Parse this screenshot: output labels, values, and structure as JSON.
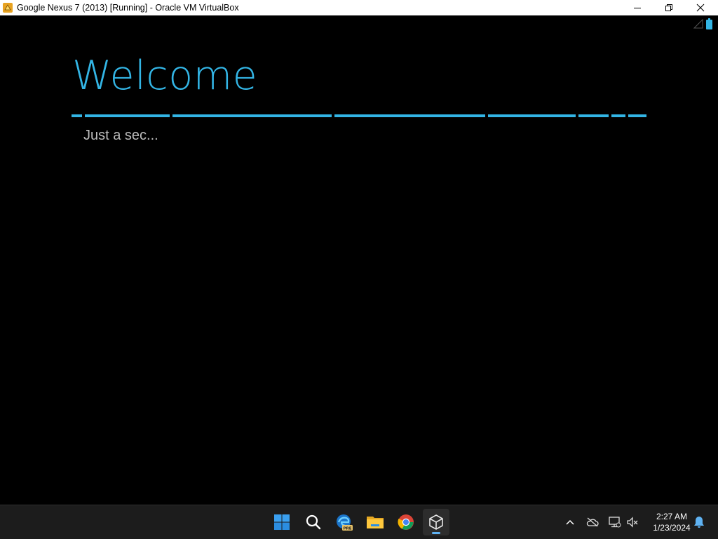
{
  "window": {
    "title": "Google Nexus 7 (2013) [Running] - Oracle VM VirtualBox",
    "controls": [
      "minimize",
      "restore",
      "close"
    ]
  },
  "android": {
    "status_icons": [
      "signal-icon",
      "battery-icon"
    ],
    "welcome_title": "Welcome",
    "subtitle": "Just a sec...",
    "accent_color": "#33b5e5"
  },
  "taskbar": {
    "apps": [
      {
        "name": "start",
        "icon": "windows-start-icon"
      },
      {
        "name": "search",
        "icon": "search-icon"
      },
      {
        "name": "edge-preview",
        "icon": "edge-pre-icon",
        "badge": "PRE"
      },
      {
        "name": "file-explorer",
        "icon": "folder-icon"
      },
      {
        "name": "chrome",
        "icon": "chrome-icon"
      },
      {
        "name": "virtualbox",
        "icon": "virtualbox-icon",
        "active": true
      }
    ],
    "tray": [
      "chevron-up-icon",
      "onedrive-offline-icon",
      "network-icon",
      "volume-muted-icon"
    ],
    "clock": {
      "time": "2:27 AM",
      "date": "1/23/2024"
    },
    "notification_icon": "bell-icon"
  }
}
